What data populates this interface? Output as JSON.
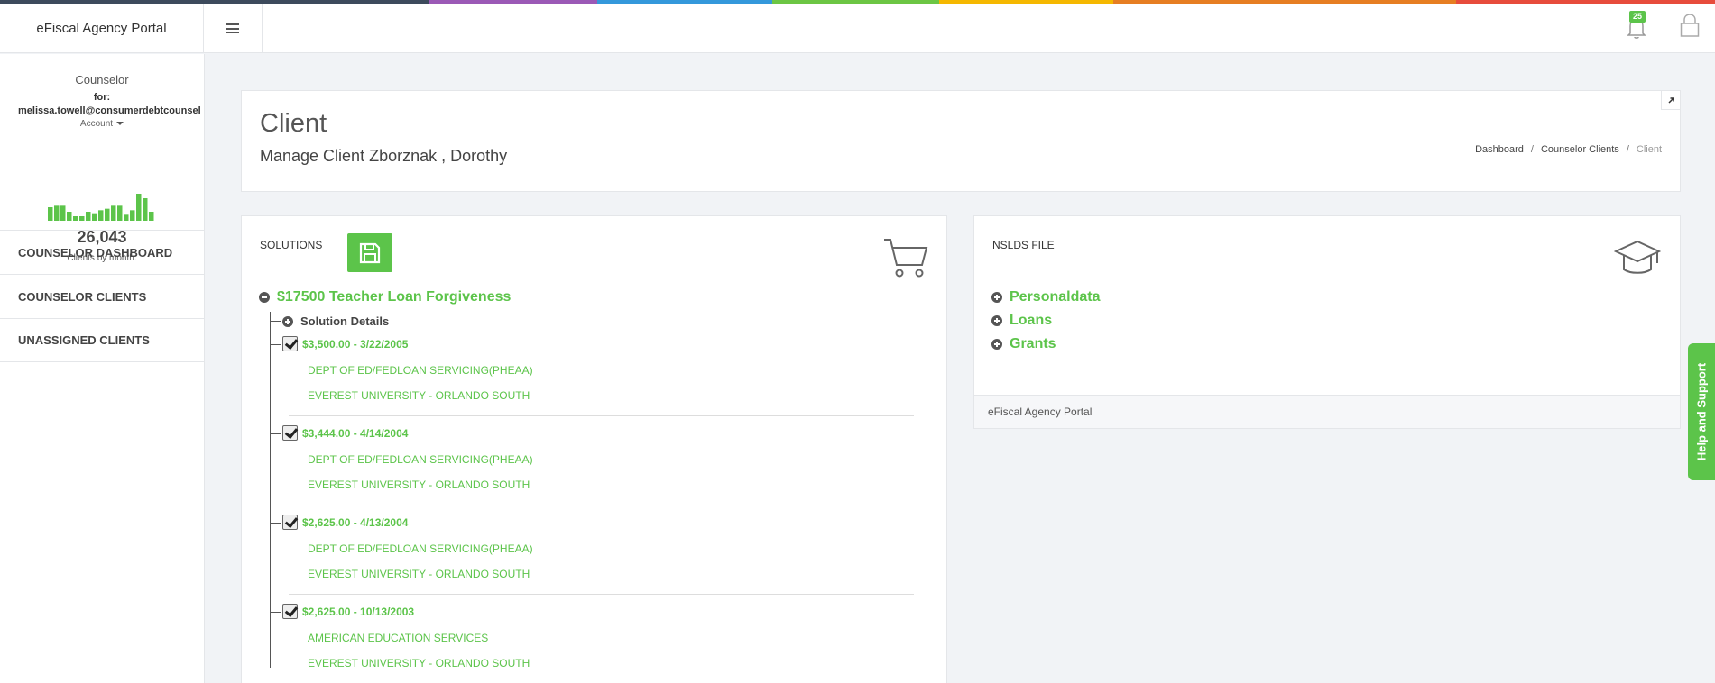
{
  "app": {
    "title": "eFiscal Agency Portal"
  },
  "colors": {
    "accent": "#5cc44a",
    "strip": [
      "#3d4a5c",
      "#9b59b6",
      "#3498db",
      "#6cc644",
      "#f5b800",
      "#e67e22",
      "#e74c3c"
    ]
  },
  "header": {
    "notification_count": "25"
  },
  "sidebar": {
    "role": "Counselor",
    "for_label": "for:",
    "email": "melissa.towell@consumerdebtcounsel",
    "account_label": "Account",
    "sparkline": [
      9,
      10,
      10,
      6,
      3,
      3,
      6,
      5,
      7,
      8,
      10,
      10,
      4,
      7,
      18,
      15,
      6
    ],
    "clients_count": "26,043",
    "clients_label": "Clients by month.",
    "nav": [
      "COUNSELOR DASHBOARD",
      "COUNSELOR CLIENTS",
      "UNASSIGNED CLIENTS"
    ]
  },
  "page": {
    "title": "Client",
    "subtitle": "Manage Client Zborznak , Dorothy",
    "breadcrumb": [
      "Dashboard",
      "Counselor Clients",
      "Client"
    ]
  },
  "solutions": {
    "label": "SOLUTIONS",
    "title": "$17500 Teacher Loan Forgiveness",
    "details_label": "Solution Details",
    "loans": [
      {
        "amount": "$3,500.00 - 3/22/2005",
        "servicer": "DEPT OF ED/FEDLOAN SERVICING(PHEAA)",
        "school": "EVEREST UNIVERSITY - ORLANDO SOUTH"
      },
      {
        "amount": "$3,444.00 - 4/14/2004",
        "servicer": "DEPT OF ED/FEDLOAN SERVICING(PHEAA)",
        "school": "EVEREST UNIVERSITY - ORLANDO SOUTH"
      },
      {
        "amount": "$2,625.00 - 4/13/2004",
        "servicer": "DEPT OF ED/FEDLOAN SERVICING(PHEAA)",
        "school": "EVEREST UNIVERSITY - ORLANDO SOUTH"
      },
      {
        "amount": "$2,625.00 - 10/13/2003",
        "servicer": "AMERICAN EDUCATION SERVICES",
        "school": "EVEREST UNIVERSITY - ORLANDO SOUTH"
      }
    ]
  },
  "nslds": {
    "label": "NSLDS FILE",
    "items": [
      "Personaldata",
      "Loans",
      "Grants"
    ],
    "footer": "eFiscal Agency Portal"
  },
  "help_tab": "Help and Support"
}
